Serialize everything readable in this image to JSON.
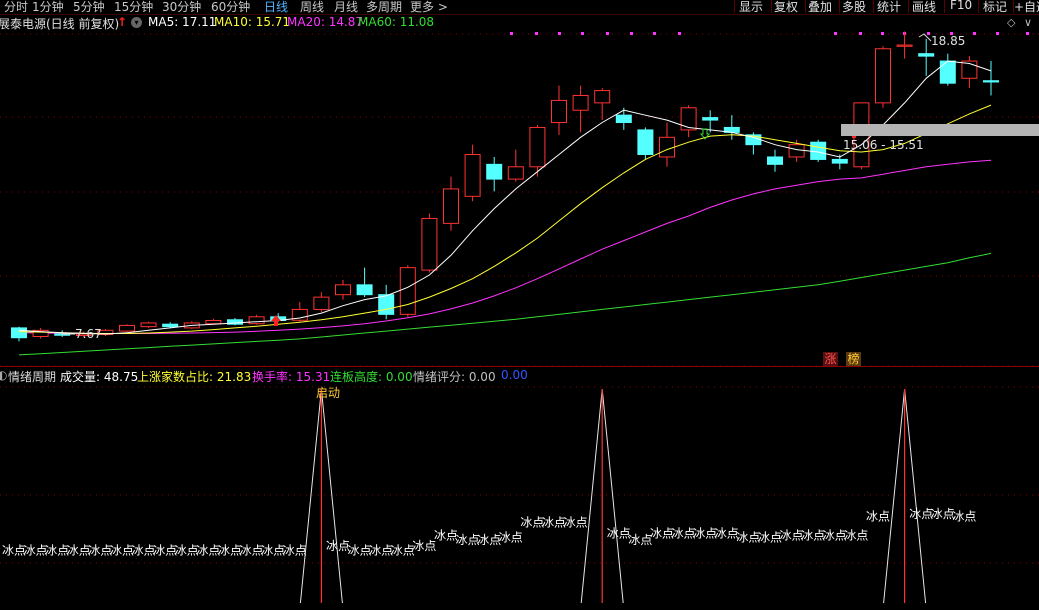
{
  "toolbar": {
    "tabs": [
      "分时",
      "1分钟",
      "5分钟",
      "15分钟",
      "30分钟",
      "60分钟",
      "日线",
      "周线",
      "月线",
      "多周期",
      "更多 >"
    ],
    "active_tab": "日线",
    "right_buttons": [
      "显示",
      "复权",
      "叠加",
      "多股",
      "统计",
      "画线",
      "F10",
      "标记",
      "+自选"
    ]
  },
  "main_panel": {
    "stock_title": "展泰电源(日线 前复权)",
    "legend": [
      {
        "label": "MA5: 17.11",
        "color": "#ffffff"
      },
      {
        "label": "MA10: 15.71",
        "color": "#ffff33"
      },
      {
        "label": "MA20: 14.87",
        "color": "#ff33ff"
      },
      {
        "label": "MA60: 11.08",
        "color": "#33dd33"
      }
    ],
    "high_label": "18.85",
    "low_label": "7.67",
    "range_label": "15.06 - 15.51",
    "badge_zhang": "涨",
    "badge_bang": "榜",
    "colors": {
      "up": "#ff3232",
      "down": "#54ffff",
      "ma5": "#ffffff",
      "ma10": "#ffff33",
      "ma20": "#ff33ff",
      "ma60": "#33dd33",
      "grid": "#8b0000"
    }
  },
  "sub_panel": {
    "indicator_name": "情绪周期",
    "values": [
      {
        "label": "成交量: 48.75",
        "color": "#ffffff"
      },
      {
        "label": "上涨家数占比: 21.83",
        "color": "#ffff33"
      },
      {
        "label": "换手率: 15.31",
        "color": "#ff33ff"
      },
      {
        "label": "连板高度: 0.00",
        "color": "#33dd33"
      },
      {
        "label": "情绪评分: 0.00",
        "color": "#c0c0c0"
      },
      {
        "label": "0.00",
        "color": "#3355ff"
      }
    ],
    "spike_label": "启动",
    "point_label": "冰点"
  },
  "chart_data": {
    "type": "candlestick",
    "price_range": [
      6.5,
      20.0
    ],
    "candles": [
      {
        "o": 8.05,
        "c": 7.65,
        "h": 8.1,
        "l": 7.5
      },
      {
        "o": 7.7,
        "c": 7.95,
        "h": 8.05,
        "l": 7.62
      },
      {
        "o": 7.8,
        "c": 7.75,
        "h": 7.95,
        "l": 7.68
      },
      {
        "o": 7.74,
        "c": 7.8,
        "h": 7.9,
        "l": 7.67
      },
      {
        "o": 7.78,
        "c": 7.95,
        "h": 8.0,
        "l": 7.72
      },
      {
        "o": 7.92,
        "c": 8.15,
        "h": 8.2,
        "l": 7.88
      },
      {
        "o": 8.1,
        "c": 8.25,
        "h": 8.3,
        "l": 8.05
      },
      {
        "o": 8.2,
        "c": 8.1,
        "h": 8.28,
        "l": 8.05
      },
      {
        "o": 8.05,
        "c": 8.25,
        "h": 8.32,
        "l": 8.0
      },
      {
        "o": 8.22,
        "c": 8.35,
        "h": 8.42,
        "l": 8.18
      },
      {
        "o": 8.38,
        "c": 8.2,
        "h": 8.45,
        "l": 8.15
      },
      {
        "o": 8.22,
        "c": 8.5,
        "h": 8.58,
        "l": 8.18
      },
      {
        "o": 8.5,
        "c": 8.35,
        "h": 8.65,
        "l": 8.3
      },
      {
        "o": 8.36,
        "c": 8.8,
        "h": 9.1,
        "l": 8.3
      },
      {
        "o": 8.8,
        "c": 9.3,
        "h": 9.5,
        "l": 8.7
      },
      {
        "o": 9.4,
        "c": 9.8,
        "h": 10.0,
        "l": 9.2
      },
      {
        "o": 9.8,
        "c": 9.4,
        "h": 10.5,
        "l": 9.3
      },
      {
        "o": 9.4,
        "c": 8.6,
        "h": 9.8,
        "l": 8.4
      },
      {
        "o": 8.6,
        "c": 10.5,
        "h": 10.6,
        "l": 8.5
      },
      {
        "o": 10.4,
        "c": 12.5,
        "h": 12.7,
        "l": 10.3
      },
      {
        "o": 12.3,
        "c": 13.7,
        "h": 14.2,
        "l": 12.0
      },
      {
        "o": 13.4,
        "c": 15.1,
        "h": 15.5,
        "l": 13.2
      },
      {
        "o": 14.7,
        "c": 14.1,
        "h": 15.0,
        "l": 13.6
      },
      {
        "o": 14.1,
        "c": 14.6,
        "h": 15.3,
        "l": 14.0
      },
      {
        "o": 14.6,
        "c": 16.2,
        "h": 16.3,
        "l": 14.2
      },
      {
        "o": 16.4,
        "c": 17.3,
        "h": 17.9,
        "l": 15.9
      },
      {
        "o": 16.9,
        "c": 17.5,
        "h": 17.9,
        "l": 16.0
      },
      {
        "o": 17.2,
        "c": 17.7,
        "h": 17.8,
        "l": 16.5
      },
      {
        "o": 16.7,
        "c": 16.4,
        "h": 17.0,
        "l": 16.1
      },
      {
        "o": 16.1,
        "c": 15.1,
        "h": 16.2,
        "l": 14.9
      },
      {
        "o": 15.0,
        "c": 15.8,
        "h": 16.4,
        "l": 14.6
      },
      {
        "o": 16.1,
        "c": 17.0,
        "h": 17.1,
        "l": 15.8
      },
      {
        "o": 16.6,
        "c": 16.5,
        "h": 16.9,
        "l": 16.0
      },
      {
        "o": 16.2,
        "c": 16.0,
        "h": 16.7,
        "l": 15.7
      },
      {
        "o": 15.9,
        "c": 15.5,
        "h": 16.0,
        "l": 15.1
      },
      {
        "o": 15.0,
        "c": 14.7,
        "h": 15.3,
        "l": 14.4
      },
      {
        "o": 15.0,
        "c": 15.5,
        "h": 15.7,
        "l": 14.8
      },
      {
        "o": 15.6,
        "c": 14.9,
        "h": 15.7,
        "l": 14.8
      },
      {
        "o": 14.9,
        "c": 14.75,
        "h": 15.1,
        "l": 14.5
      },
      {
        "o": 14.6,
        "c": 17.2,
        "h": 17.2,
        "l": 14.5
      },
      {
        "o": 17.2,
        "c": 19.4,
        "h": 19.5,
        "l": 17.0
      },
      {
        "o": 19.5,
        "c": 19.55,
        "h": 20.1,
        "l": 19.0
      },
      {
        "o": 19.2,
        "c": 19.1,
        "h": 19.8,
        "l": 18.3
      },
      {
        "o": 18.9,
        "c": 18.0,
        "h": 19.2,
        "l": 17.9
      },
      {
        "o": 18.2,
        "c": 18.9,
        "h": 19.1,
        "l": 17.8
      },
      {
        "o": 18.1,
        "c": 18.05,
        "h": 18.9,
        "l": 17.5
      }
    ],
    "ma5": [
      7.95,
      7.9,
      7.85,
      7.82,
      7.8,
      7.85,
      7.95,
      8.05,
      8.15,
      8.2,
      8.25,
      8.3,
      8.35,
      8.45,
      8.65,
      8.95,
      9.2,
      9.35,
      9.7,
      10.2,
      11.0,
      12.0,
      12.9,
      13.7,
      14.4,
      15.1,
      15.8,
      16.4,
      16.9,
      16.7,
      16.5,
      16.2,
      16.1,
      16.0,
      15.8,
      15.5,
      15.3,
      15.2,
      15.0,
      15.5,
      16.3,
      17.2,
      18.2,
      18.9,
      18.8,
      18.5
    ],
    "ma10": [
      7.9,
      7.88,
      7.85,
      7.83,
      7.82,
      7.82,
      7.84,
      7.88,
      7.92,
      7.98,
      8.05,
      8.12,
      8.2,
      8.28,
      8.38,
      8.5,
      8.65,
      8.8,
      9.0,
      9.3,
      9.65,
      10.05,
      10.55,
      11.1,
      11.7,
      12.4,
      13.1,
      13.75,
      14.35,
      14.9,
      15.3,
      15.6,
      15.85,
      15.9,
      15.85,
      15.7,
      15.55,
      15.4,
      15.25,
      15.2,
      15.3,
      15.55,
      15.95,
      16.35,
      16.75,
      17.11
    ],
    "ma20": [
      7.85,
      7.84,
      7.83,
      7.82,
      7.82,
      7.82,
      7.82,
      7.83,
      7.84,
      7.86,
      7.88,
      7.91,
      7.95,
      8.0,
      8.06,
      8.13,
      8.22,
      8.33,
      8.46,
      8.62,
      8.82,
      9.06,
      9.35,
      9.68,
      10.05,
      10.45,
      10.85,
      11.25,
      11.6,
      11.95,
      12.3,
      12.6,
      12.95,
      13.25,
      13.5,
      13.7,
      13.85,
      14.0,
      14.1,
      14.15,
      14.3,
      14.45,
      14.6,
      14.7,
      14.8,
      14.87
    ],
    "ma60": [
      6.95,
      7.0,
      7.05,
      7.1,
      7.15,
      7.2,
      7.25,
      7.3,
      7.35,
      7.4,
      7.45,
      7.5,
      7.55,
      7.6,
      7.68,
      7.76,
      7.84,
      7.92,
      8.0,
      8.08,
      8.16,
      8.24,
      8.32,
      8.4,
      8.5,
      8.6,
      8.7,
      8.8,
      8.9,
      9.0,
      9.1,
      9.2,
      9.3,
      9.4,
      9.5,
      9.6,
      9.7,
      9.8,
      9.95,
      10.1,
      10.25,
      10.4,
      10.55,
      10.7,
      10.9,
      11.08
    ],
    "indicator": {
      "spike_indices": [
        14,
        27,
        41
      ],
      "points": [
        {
          "i": 0,
          "v": 0.25
        },
        {
          "i": 1,
          "v": 0.25
        },
        {
          "i": 2,
          "v": 0.25
        },
        {
          "i": 3,
          "v": 0.25
        },
        {
          "i": 4,
          "v": 0.25
        },
        {
          "i": 5,
          "v": 0.25
        },
        {
          "i": 6,
          "v": 0.25
        },
        {
          "i": 7,
          "v": 0.25
        },
        {
          "i": 8,
          "v": 0.25
        },
        {
          "i": 9,
          "v": 0.25
        },
        {
          "i": 10,
          "v": 0.25
        },
        {
          "i": 11,
          "v": 0.25
        },
        {
          "i": 12,
          "v": 0.25
        },
        {
          "i": 13,
          "v": 0.25
        },
        {
          "i": 15,
          "v": 0.27
        },
        {
          "i": 16,
          "v": 0.25
        },
        {
          "i": 17,
          "v": 0.25
        },
        {
          "i": 18,
          "v": 0.25
        },
        {
          "i": 19,
          "v": 0.27
        },
        {
          "i": 20,
          "v": 0.32
        },
        {
          "i": 21,
          "v": 0.3
        },
        {
          "i": 22,
          "v": 0.3
        },
        {
          "i": 23,
          "v": 0.31
        },
        {
          "i": 24,
          "v": 0.38
        },
        {
          "i": 25,
          "v": 0.38
        },
        {
          "i": 26,
          "v": 0.38
        },
        {
          "i": 28,
          "v": 0.33
        },
        {
          "i": 29,
          "v": 0.3
        },
        {
          "i": 30,
          "v": 0.33
        },
        {
          "i": 31,
          "v": 0.33
        },
        {
          "i": 32,
          "v": 0.33
        },
        {
          "i": 33,
          "v": 0.33
        },
        {
          "i": 34,
          "v": 0.31
        },
        {
          "i": 35,
          "v": 0.31
        },
        {
          "i": 36,
          "v": 0.32
        },
        {
          "i": 37,
          "v": 0.32
        },
        {
          "i": 38,
          "v": 0.32
        },
        {
          "i": 39,
          "v": 0.32
        },
        {
          "i": 40,
          "v": 0.41
        },
        {
          "i": 42,
          "v": 0.42
        },
        {
          "i": 43,
          "v": 0.42
        },
        {
          "i": 44,
          "v": 0.41
        }
      ]
    }
  }
}
